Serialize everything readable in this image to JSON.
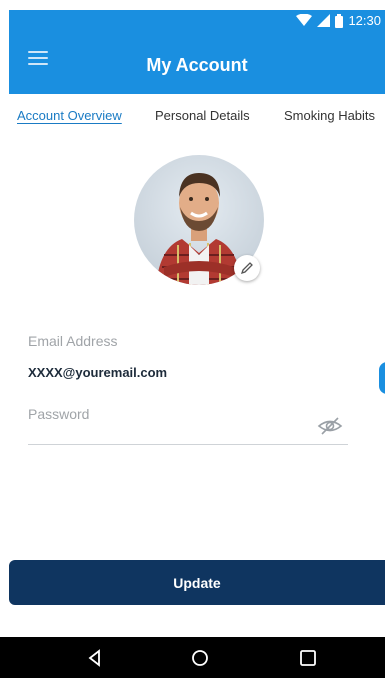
{
  "status_bar": {
    "time": "12:30",
    "icons": [
      "wifi-icon",
      "signal-icon",
      "battery-icon"
    ]
  },
  "app_bar": {
    "menu_icon": "hamburger-menu-icon",
    "title": "My Account",
    "color": "#1a8fe0"
  },
  "tabs": [
    {
      "label": "Account Overview",
      "active": true
    },
    {
      "label": "Personal Details",
      "active": false
    },
    {
      "label": "Smoking Habits",
      "active": false
    }
  ],
  "profile": {
    "avatar": "profile-photo",
    "edit_icon": "pencil-icon"
  },
  "form": {
    "email_label": "Email Address",
    "email_value": "XXXX@youremail.com",
    "password_label": "Password",
    "password_toggle_icon": "eye-slash-icon"
  },
  "actions": {
    "update_label": "Update",
    "button_color": "#0f3560"
  },
  "nav_bar": {
    "buttons": [
      "back-triangle-icon",
      "home-circle-icon",
      "recents-square-icon"
    ]
  }
}
